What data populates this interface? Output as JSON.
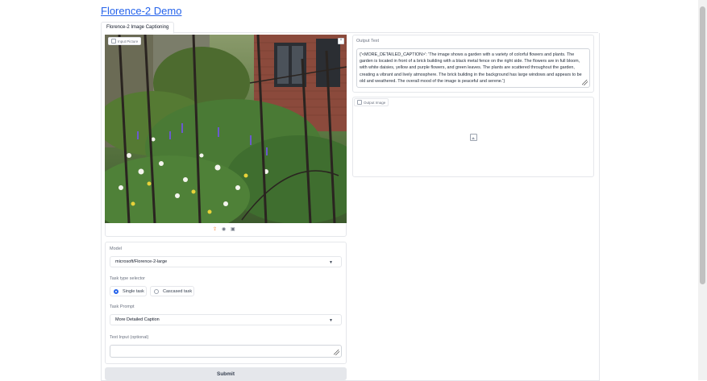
{
  "app": {
    "title": "Florence-2 Demo"
  },
  "tabs": [
    {
      "label": "Florence-2 Image Captioning"
    }
  ],
  "input_image": {
    "label": "Input Picture"
  },
  "model": {
    "label": "Model",
    "value": "microsoft/Florence-2-large"
  },
  "task_type": {
    "label": "Task type selector",
    "options": [
      {
        "label": "Single task",
        "selected": true
      },
      {
        "label": "Cascased task",
        "selected": false
      }
    ]
  },
  "task_prompt": {
    "label": "Task Prompt",
    "value": "More Detailed Caption"
  },
  "text_input": {
    "label": "Text Input (optional)",
    "value": ""
  },
  "submit": {
    "label": "Submit"
  },
  "output_text": {
    "label": "Output Text",
    "value": "{'<MORE_DETAILED_CAPTION>': 'The image shows a garden with a variety of colorful flowers and plants. The garden is located in front of a brick building with a black metal fence on the right side. The flowers are in full bloom, with white daisies, yellow and purple flowers, and green leaves. The plants are scattered throughout the garden, creating a vibrant and lively atmosphere. The brick building in the background has large windows and appears to be old and weathered. The overall mood of the image is peaceful and serene.'}"
  },
  "output_image": {
    "label": "Output Image"
  },
  "colors": {
    "accent": "#2563eb",
    "border": "#e5e7eb",
    "button_bg": "#e5e7eb"
  }
}
